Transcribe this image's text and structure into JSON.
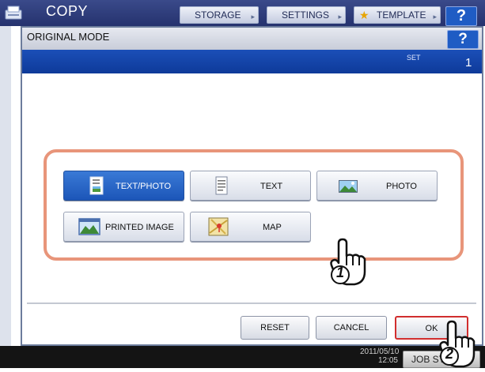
{
  "app": {
    "title": "COPY",
    "tabs": [
      {
        "label": "STORAGE"
      },
      {
        "label": "SETTINGS"
      },
      {
        "label": "TEMPLATE"
      }
    ],
    "help_label": "?",
    "datetime": "2011/05/10 12:05",
    "job_status_label": "JOB STATUS"
  },
  "dialog": {
    "title": "ORIGINAL MODE",
    "help_label": "?",
    "set_label": "SET",
    "set_count": "1",
    "modes": [
      {
        "label": "TEXT/PHOTO",
        "icon": "text-photo-icon",
        "selected": true
      },
      {
        "label": "TEXT",
        "icon": "text-icon",
        "selected": false
      },
      {
        "label": "PHOTO",
        "icon": "photo-icon",
        "selected": false
      },
      {
        "label": "PRINTED IMAGE",
        "icon": "printed-image-icon",
        "selected": false
      },
      {
        "label": "MAP",
        "icon": "map-icon",
        "selected": false
      }
    ],
    "buttons": {
      "reset": "RESET",
      "cancel": "CANCEL",
      "ok": "OK"
    }
  },
  "annotations": [
    {
      "step": "1",
      "icon": "hand-pointer-icon"
    },
    {
      "step": "2",
      "icon": "hand-pointer-icon"
    }
  ],
  "colors": {
    "accent_blue": "#1c56b8",
    "frame_highlight": "#e8957a",
    "ok_border": "#d12e2e"
  }
}
